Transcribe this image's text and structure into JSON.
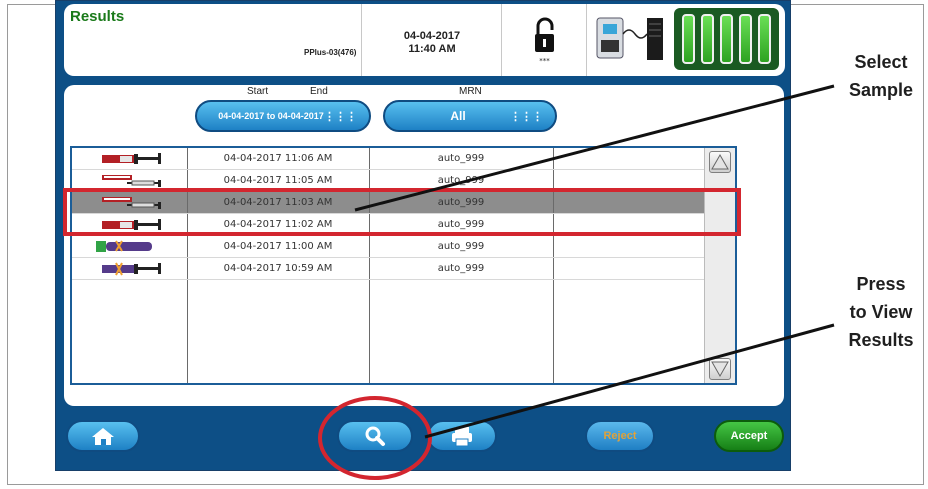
{
  "header": {
    "title": "Results",
    "device_id": "PPlus-03(476)",
    "date": "04-04-2017",
    "time": "11:40 AM",
    "lock_caption": "***"
  },
  "filters": {
    "start_label": "Start",
    "end_label": "End",
    "range_value": "04-04-2017 to 04-04-2017",
    "mrn_label": "MRN",
    "mrn_value": "All"
  },
  "samples": [
    {
      "type": "syringe-red-icon",
      "datetime": "04-04-2017 11:06 AM",
      "mrn": "auto_999",
      "selected": false
    },
    {
      "type": "syringe-thin-icon",
      "datetime": "04-04-2017 11:05 AM",
      "mrn": "auto_999",
      "selected": false
    },
    {
      "type": "syringe-thin-icon",
      "datetime": "04-04-2017 11:03 AM",
      "mrn": "auto_999",
      "selected": true
    },
    {
      "type": "syringe-red-icon",
      "datetime": "04-04-2017 11:02 AM",
      "mrn": "auto_999",
      "selected": false
    },
    {
      "type": "capillary-tube-icon",
      "datetime": "04-04-2017 11:00 AM",
      "mrn": "auto_999",
      "selected": false
    },
    {
      "type": "syringe-purple-icon",
      "datetime": "04-04-2017 10:59 AM",
      "mrn": "auto_999",
      "selected": false
    }
  ],
  "buttons": {
    "home": "home-icon",
    "view": "search-icon",
    "print": "print-icon",
    "reject": "Reject",
    "accept": "Accept"
  },
  "callouts": {
    "select_line1": "Select",
    "select_line2": "Sample",
    "press_line1": "Press",
    "press_line2": "to View",
    "press_line3": "Results"
  },
  "colors": {
    "device_blue": "#0d4f86",
    "title_green": "#1a7a1a",
    "highlight_red": "#d3262f",
    "accept_green": "#23a123",
    "reject_orange": "#e0a23a"
  }
}
